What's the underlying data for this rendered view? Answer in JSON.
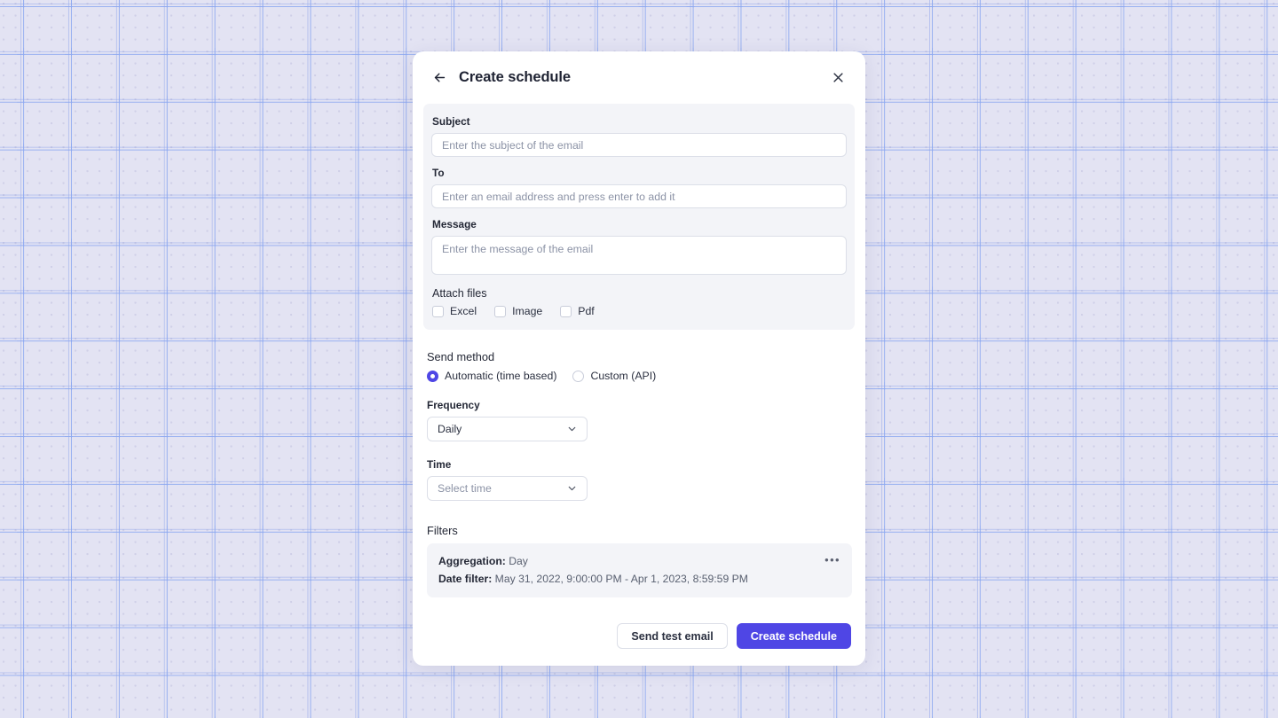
{
  "header": {
    "title": "Create schedule",
    "back_icon": "arrow-left-icon",
    "close_icon": "close-icon"
  },
  "email": {
    "subject": {
      "label": "Subject",
      "value": "",
      "placeholder": "Enter the subject of the email"
    },
    "to": {
      "label": "To",
      "value": "",
      "placeholder": "Enter an email address and press enter to add it"
    },
    "message": {
      "label": "Message",
      "value": "",
      "placeholder": "Enter the message of the email"
    },
    "attach": {
      "title": "Attach files",
      "options": [
        {
          "label": "Excel",
          "checked": false
        },
        {
          "label": "Image",
          "checked": false
        },
        {
          "label": "Pdf",
          "checked": false
        }
      ]
    }
  },
  "send_method": {
    "title": "Send method",
    "options": [
      {
        "label": "Automatic (time based)",
        "selected": true
      },
      {
        "label": "Custom (API)",
        "selected": false
      }
    ]
  },
  "frequency": {
    "label": "Frequency",
    "value": "Daily",
    "is_placeholder": false,
    "chevron_icon": "chevron-down-icon"
  },
  "time": {
    "label": "Time",
    "value": "Select time",
    "is_placeholder": true,
    "chevron_icon": "chevron-down-icon"
  },
  "filters": {
    "title": "Filters",
    "aggregation_label": "Aggregation:",
    "aggregation_value": "Day",
    "date_filter_label": "Date filter:",
    "date_filter_value": "May 31, 2022, 9:00:00 PM - Apr 1, 2023, 8:59:59 PM",
    "menu_icon": "more-horizontal-icon",
    "menu_glyph": "•••"
  },
  "footer": {
    "test_label": "Send test email",
    "submit_label": "Create schedule"
  },
  "colors": {
    "accent": "#4F46E5",
    "page_background": "#E3E3F3",
    "panel": "#F3F4F8"
  }
}
